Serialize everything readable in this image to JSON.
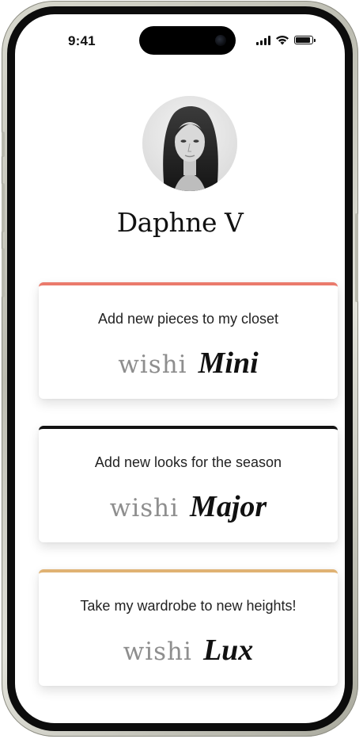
{
  "status_bar": {
    "time": "9:41"
  },
  "profile": {
    "name": "Daphne V"
  },
  "plans": [
    {
      "subtitle": "Add new pieces to my closet",
      "brand": "wishi",
      "tier": "Mini",
      "accent": "#ea7a6c"
    },
    {
      "subtitle": "Add new looks for the season",
      "brand": "wishi",
      "tier": "Major",
      "accent": "#111111"
    },
    {
      "subtitle": "Take my wardrobe to new heights!",
      "brand": "wishi",
      "tier": "Lux",
      "accent": "#e0b273"
    }
  ],
  "icons": [
    "signal-icon",
    "wifi-icon",
    "battery-icon"
  ]
}
